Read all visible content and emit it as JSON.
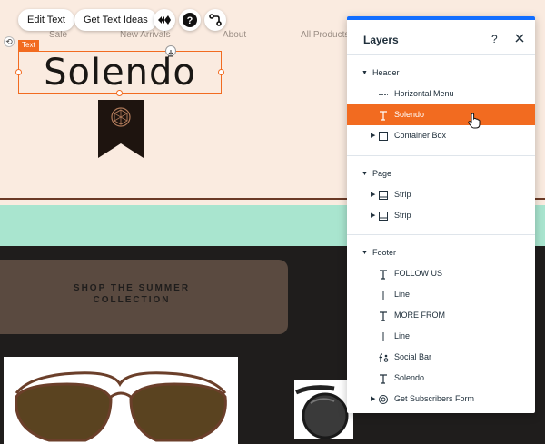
{
  "site": {
    "nav": [
      "Sale",
      "New Arrivals",
      "About",
      "All Products"
    ],
    "logo_text": "Solendo",
    "cta_text": "SHOP THE SUMMER\nCOLLECTION"
  },
  "selection": {
    "tag": "Text"
  },
  "toolbar": {
    "edit_text": "Edit Text",
    "get_text_ideas": "Get Text Ideas"
  },
  "layers_panel": {
    "title": "Layers",
    "help": "?",
    "groups": [
      {
        "label": "Header",
        "items": [
          {
            "label": "Horizontal Menu",
            "icon": "menu-icon"
          },
          {
            "label": "Solendo",
            "icon": "text-icon",
            "selected": true
          },
          {
            "label": "Container Box",
            "icon": "box-icon",
            "expandable": true
          }
        ]
      },
      {
        "label": "Page",
        "items": [
          {
            "label": "Strip",
            "icon": "strip-icon",
            "expandable": true
          },
          {
            "label": "Strip",
            "icon": "strip-icon",
            "expandable": true
          }
        ]
      },
      {
        "label": "Footer",
        "items": [
          {
            "label": "FOLLOW US",
            "icon": "text-icon"
          },
          {
            "label": "Line",
            "icon": "line-icon"
          },
          {
            "label": "MORE FROM",
            "icon": "text-icon"
          },
          {
            "label": "Line",
            "icon": "line-icon"
          },
          {
            "label": "Social Bar",
            "icon": "social-bar-icon"
          },
          {
            "label": "Solendo",
            "icon": "text-icon"
          },
          {
            "label": "Get Subscribers Form",
            "icon": "form-icon",
            "expandable": true
          }
        ]
      }
    ]
  },
  "colors": {
    "accent": "#116dff",
    "selection": "#f26b20",
    "header_bg": "#faebe0",
    "mint": "#a9e5cf",
    "dark": "#1f1d1c"
  }
}
